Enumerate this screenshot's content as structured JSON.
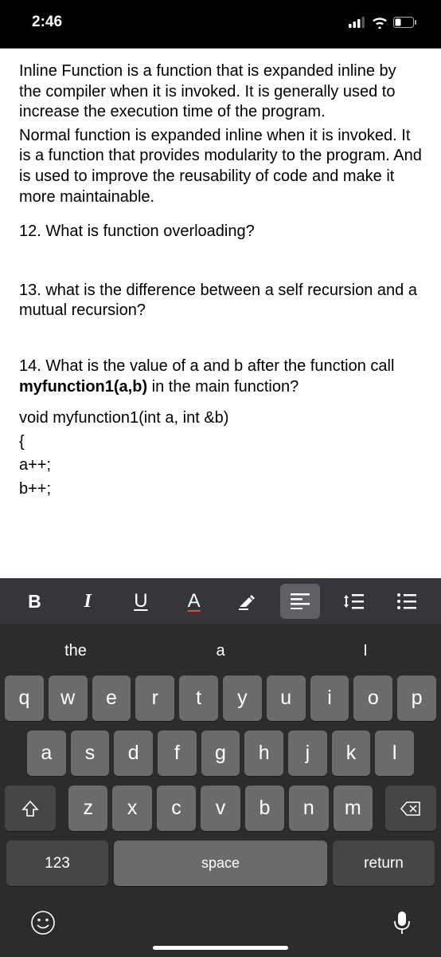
{
  "status": {
    "time": "2:46"
  },
  "document": {
    "p1": "Inline Function is a function that is expanded inline by the compiler when it is invoked. It is generally used to increase the execution time of the program.",
    "p2": "Normal function is expanded inline when it is invoked.  It is a function that provides modularity to the program. And is used to improve the reusability of code and make it more maintainable.",
    "q12": "12. What is function overloading?",
    "q13": "13. what is the difference between a self recursion and a mutual recursion?",
    "q14_a": "14. What is the value of a and b after the function call ",
    "q14_b": "myfunction1(a,b)",
    "q14_c": " in the main function?",
    "code1": "void myfunction1(int a, int &b)",
    "code2": "{",
    "code3": "a++;",
    "code4": "b++;"
  },
  "format": {
    "bold": "B",
    "italic": "I",
    "underline": "U",
    "color": "A"
  },
  "suggestions": {
    "s1": "the",
    "s2": "a",
    "s3": "I"
  },
  "keys": {
    "row1": [
      "q",
      "w",
      "e",
      "r",
      "t",
      "y",
      "u",
      "i",
      "o",
      "p"
    ],
    "row2": [
      "a",
      "s",
      "d",
      "f",
      "g",
      "h",
      "j",
      "k",
      "l"
    ],
    "row3": [
      "z",
      "x",
      "c",
      "v",
      "b",
      "n",
      "m"
    ],
    "num": "123",
    "space": "space",
    "return": "return"
  }
}
